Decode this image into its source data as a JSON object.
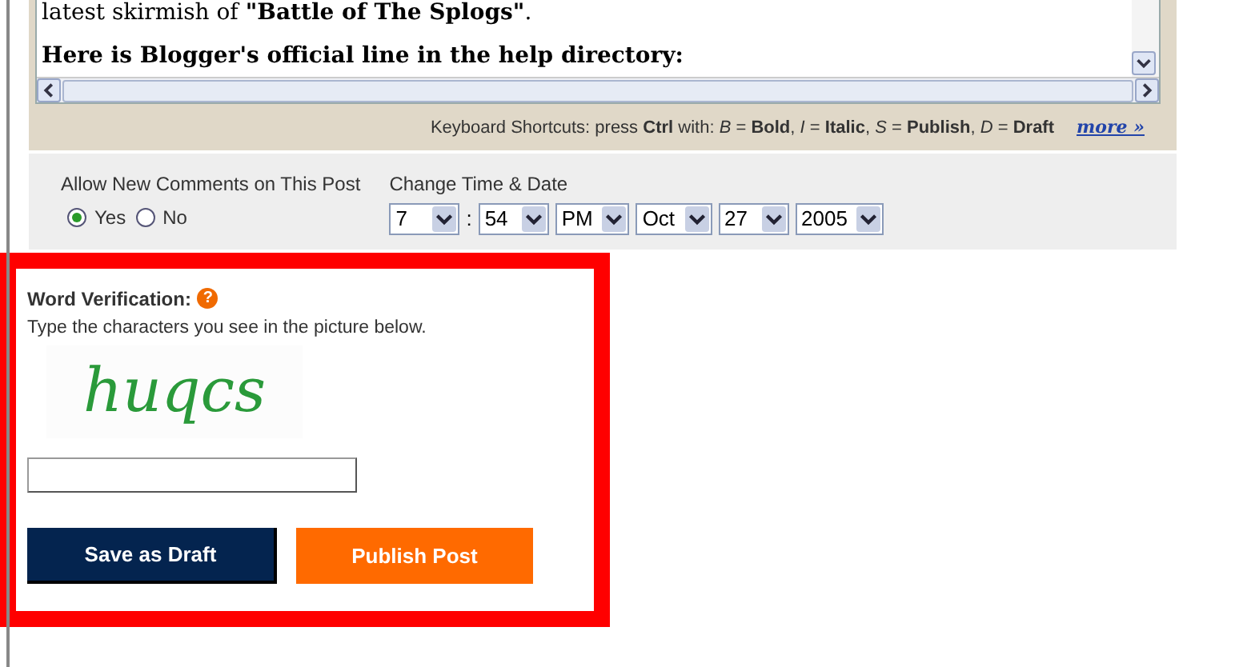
{
  "editor": {
    "paragraphs": [
      {
        "text": "latest skirmish of **\"Battle of The Splogs\"**.",
        "bold": false
      },
      {
        "text": "Here is Blogger's official line in the help directory:",
        "bold": true
      }
    ],
    "shortcuts": "Keyboard Shortcuts: press **Ctrl** with: *B* = **Bold**, *I* = **Italic**, *S* = **Publish**, *D* = **Draft**",
    "more_link": "more »"
  },
  "comments": {
    "label": "Allow New Comments on This Post",
    "options": [
      {
        "label": "Yes",
        "selected": true
      },
      {
        "label": "No",
        "selected": false
      }
    ]
  },
  "time_date": {
    "label": "Change Time & Date",
    "separator": ":",
    "selects": [
      {
        "value": "7"
      },
      {
        "value": "54"
      },
      {
        "value": "PM"
      },
      {
        "value": "Oct"
      },
      {
        "value": "27"
      },
      {
        "value": "2005"
      }
    ]
  },
  "verification": {
    "title": "Word Verification:",
    "help_icon": "?",
    "instruction": "Type the characters you see in the picture below.",
    "captcha": "huqcs"
  },
  "buttons": [
    {
      "label": "Save as Draft",
      "kind": "draft"
    },
    {
      "label": "Publish Post",
      "kind": "publish"
    }
  ]
}
